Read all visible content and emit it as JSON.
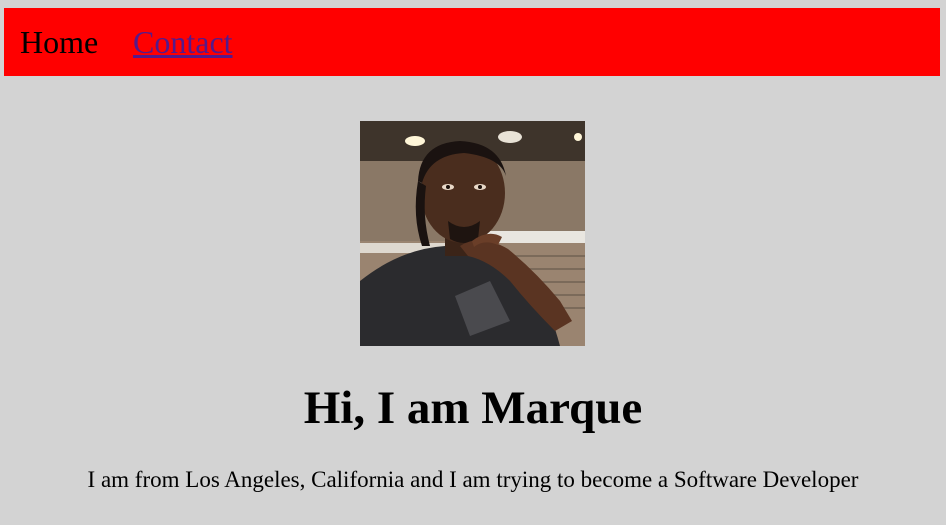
{
  "nav": {
    "home_label": "Home",
    "contact_label": "Contact"
  },
  "hero": {
    "heading": "Hi, I am Marque",
    "bio": "I am from Los Angeles, California and I am trying to become a Software Developer"
  },
  "colors": {
    "page_background": "#d3d3d3",
    "nav_background": "#ff0000",
    "link_visited": "#551a8b"
  }
}
